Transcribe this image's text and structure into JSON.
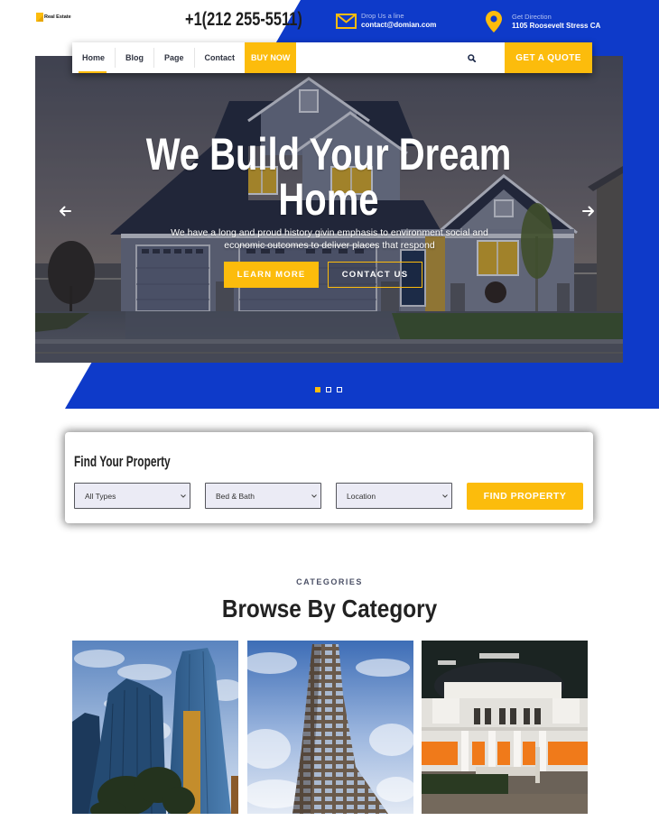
{
  "header": {
    "logo_text": "Real Estate",
    "phone": "+1(212 255-5511)",
    "email": {
      "icon": "envelope-icon",
      "label": "Drop Us a line",
      "value": "contact@domian.com"
    },
    "direction": {
      "icon": "map-pin-icon",
      "label": "Get Direction",
      "value": "1105 Roosevelt Stress CA"
    }
  },
  "nav": {
    "items": [
      {
        "label": "Home",
        "active": true
      },
      {
        "label": "Blog",
        "active": false
      },
      {
        "label": "Page",
        "active": false
      },
      {
        "label": "Contact",
        "active": false
      }
    ],
    "buy_now": "BUY NOW",
    "search_icon": "search-icon",
    "quote_button": "GET A QUOTE"
  },
  "hero": {
    "title": "We Build Your Dream Home",
    "subtitle": "We have a long and proud history givin emphasis to environment social and economic outcomes to deliver places that respond",
    "primary_button": "LEARN MORE",
    "secondary_button": "CONTACT US",
    "prev_icon": "arrow-left-icon",
    "next_icon": "arrow-right-icon",
    "background_image": "suburban-house-at-dusk"
  },
  "slider": {
    "total": 3,
    "active": 1
  },
  "search": {
    "title": "Find Your Property",
    "filters": [
      {
        "name": "type",
        "value": "All Types"
      },
      {
        "name": "bed-bath",
        "value": "Bed & Bath"
      },
      {
        "name": "location",
        "value": "Location"
      }
    ],
    "submit": "FIND PROPERTY"
  },
  "categories": {
    "eyebrow": "CATEGORIES",
    "title": "Browse By Category",
    "items": [
      {
        "image": "glass-skyscrapers"
      },
      {
        "image": "tall-residential-tower"
      },
      {
        "image": "classical-building-at-night"
      }
    ]
  },
  "colors": {
    "brand_blue": "#0e3ac9",
    "accent_yellow": "#fcbc0c",
    "text_dark": "#222222"
  }
}
